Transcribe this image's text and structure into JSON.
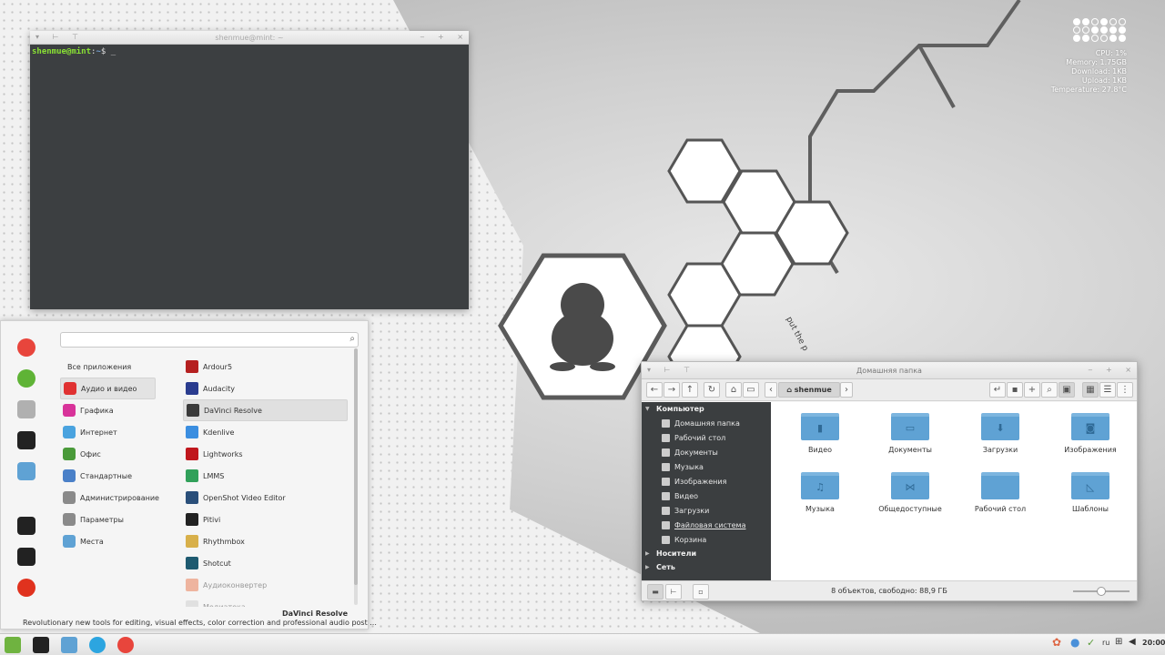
{
  "terminal": {
    "title": "shenmue@mint: ~",
    "prompt_user": "shenmue@mint",
    "prompt_sep": ":",
    "prompt_path": "~",
    "prompt_symbol": "$ _"
  },
  "sysmon": {
    "cpu": "CPU:  1%",
    "memory": "Memory:  1.75GB",
    "download": "Download:  1KB",
    "upload": "Upload:  1KB",
    "temperature": "Temperature:  27.8°C"
  },
  "wallpaper_text": "put the p",
  "menu": {
    "search_placeholder": "",
    "favorites": [
      {
        "icon": "chrome-icon",
        "color": "#e8453c"
      },
      {
        "icon": "network-globe-icon",
        "color": "#5fb336"
      },
      {
        "icon": "settings-toggle-icon",
        "color": "#b0b0b0"
      },
      {
        "icon": "terminal-icon",
        "color": "#222222"
      },
      {
        "icon": "folder-icon",
        "color": "#5fa2d4"
      },
      {
        "icon": "lock-icon",
        "color": "#222222"
      },
      {
        "icon": "logout-icon",
        "color": "#222222"
      },
      {
        "icon": "power-icon",
        "color": "#e0321e"
      }
    ],
    "categories": [
      {
        "label": "Все приложения",
        "color": ""
      },
      {
        "label": "Аудио и видео",
        "color": "#e03131"
      },
      {
        "label": "Графика",
        "color": "#d8339a"
      },
      {
        "label": "Интернет",
        "color": "#4aa3df"
      },
      {
        "label": "Офис",
        "color": "#4a9a3a"
      },
      {
        "label": "Стандартные",
        "color": "#4a80c8"
      },
      {
        "label": "Администрирование",
        "color": "#8a8a8a"
      },
      {
        "label": "Параметры",
        "color": "#8a8a8a"
      },
      {
        "label": "Места",
        "color": "#5fa2d4"
      }
    ],
    "apps": [
      {
        "label": "Ardour5",
        "color": "#b52020"
      },
      {
        "label": "Audacity",
        "color": "#2a3c8f"
      },
      {
        "label": "DaVinci Resolve",
        "color": "#3a3a3a"
      },
      {
        "label": "Kdenlive",
        "color": "#3b8ee0"
      },
      {
        "label": "Lightworks",
        "color": "#c0171d"
      },
      {
        "label": "LMMS",
        "color": "#31a05a"
      },
      {
        "label": "OpenShot Video Editor",
        "color": "#2a4f7a"
      },
      {
        "label": "Pitivi",
        "color": "#222222"
      },
      {
        "label": "Rhythmbox",
        "color": "#d8b04a"
      },
      {
        "label": "Shotcut",
        "color": "#1e5a70"
      },
      {
        "label": "Аудиоконвертер",
        "color": "#e8734a"
      },
      {
        "label": "Медиатека",
        "color": "#cccccc"
      }
    ],
    "selected_app_title": "DaVinci Resolve",
    "selected_app_description": "Revolutionary new tools for editing, visual effects, color correction and professional audio post ..."
  },
  "filemanager": {
    "title": "Домашняя папка",
    "location": "shenmue",
    "sidebar": {
      "computer": "Компьютер",
      "places": [
        "Домашняя папка",
        "Рабочий стол",
        "Документы",
        "Музыка",
        "Изображения",
        "Видео",
        "Загрузки",
        "Файловая система",
        "Корзина"
      ],
      "devices": "Носители",
      "network": "Сеть"
    },
    "files": [
      {
        "label": "Видео",
        "icon": "film-icon"
      },
      {
        "label": "Документы",
        "icon": "document-icon"
      },
      {
        "label": "Загрузки",
        "icon": "download-icon"
      },
      {
        "label": "Изображения",
        "icon": "camera-icon"
      },
      {
        "label": "Музыка",
        "icon": "music-icon"
      },
      {
        "label": "Общедоступные",
        "icon": "share-icon"
      },
      {
        "label": "Рабочий стол",
        "icon": "desktop-icon"
      },
      {
        "label": "Шаблоны",
        "icon": "template-icon"
      }
    ],
    "status": "8 объектов, свободно: 88,9 ГБ",
    "zoom_level": 0.5
  },
  "panel": {
    "launchers": [
      {
        "icon": "mint-menu-icon",
        "color": "#6fb340"
      },
      {
        "icon": "terminal-icon",
        "color": "#222222"
      },
      {
        "icon": "folder-icon",
        "color": "#5fa2d4"
      },
      {
        "icon": "telegram-icon",
        "color": "#2ca5e0"
      },
      {
        "icon": "chrome-icon",
        "color": "#e8453c"
      }
    ],
    "keyboard_layout": "ru",
    "clock": "20:00"
  }
}
